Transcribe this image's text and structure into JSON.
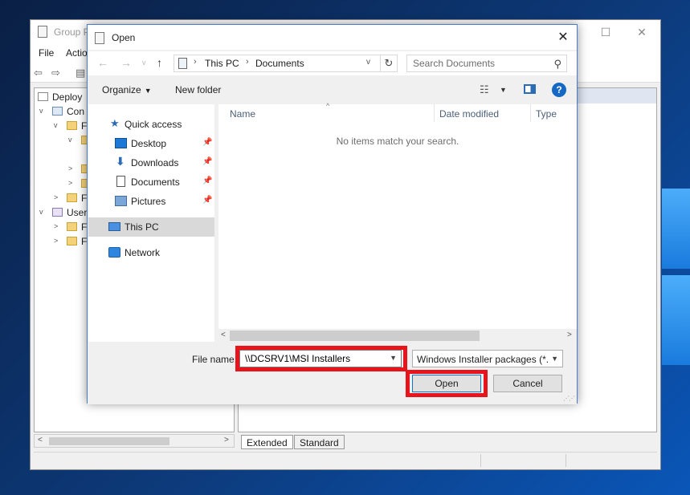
{
  "background_window": {
    "title": "Group P",
    "menu": [
      "File",
      "Actio"
    ],
    "tree": [
      "Deploy",
      "Con",
      "F",
      "F",
      "User",
      "F",
      "F"
    ],
    "tabs": [
      "Extended",
      "Standard"
    ],
    "controls": {
      "minimize": "—",
      "maximize": "☐",
      "close": "✕"
    }
  },
  "dialog": {
    "title": "Open",
    "close_glyph": "✕",
    "address": {
      "crumbs": [
        "This PC",
        "Documents"
      ]
    },
    "search": {
      "placeholder": "Search Documents"
    },
    "commands": {
      "organize": "Organize",
      "new_folder": "New folder",
      "help": "?"
    },
    "nav_items": [
      {
        "label": "Quick access",
        "icon": "star-icon"
      },
      {
        "label": "Desktop",
        "icon": "desktop-icon",
        "pinned": true
      },
      {
        "label": "Downloads",
        "icon": "download-icon",
        "pinned": true
      },
      {
        "label": "Documents",
        "icon": "documents-icon",
        "pinned": true
      },
      {
        "label": "Pictures",
        "icon": "pictures-icon",
        "pinned": true
      },
      {
        "label": "This PC",
        "icon": "computer-icon",
        "selected": true
      },
      {
        "label": "Network",
        "icon": "network-icon"
      }
    ],
    "columns": [
      "Name",
      "Date modified",
      "Type"
    ],
    "empty_message": "No items match your search.",
    "file_name_label": "File name:",
    "file_name_value": "\\\\DCSRV1\\MSI Installers",
    "file_type": "Windows Installer packages (*.msi)",
    "open_button": "Open",
    "cancel_button": "Cancel"
  },
  "colors": {
    "highlight": "#e8141c",
    "accent": "#0078d7"
  }
}
